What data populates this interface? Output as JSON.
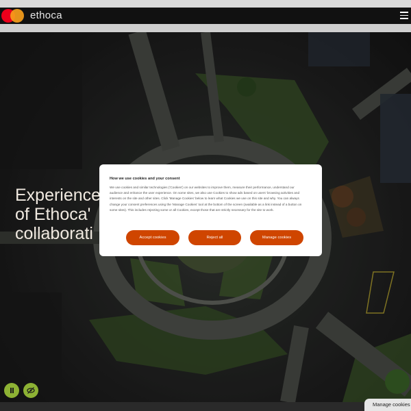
{
  "header": {
    "brand": "ethoca"
  },
  "hero": {
    "headline_lines": [
      "Experience",
      "of Ethoca'",
      "collaborati"
    ]
  },
  "controls": {
    "pause": "pause-control",
    "hide": "eye-off-control"
  },
  "cookie_modal": {
    "title": "How we use cookies and your consent",
    "body": "We use cookies and similar technologies ('Cookies') on our websites to improve them, measure their performance, understand our audience and enhance the user experience. On some sites, we also use Cookies to show ads based on users' browsing activities and interests on the site and other sites. Click 'Manage Cookies' below to learn what Cookies we use on this site and why. You can always change your consent preferences using the 'Manage Cookies' tool at the bottom of the screen (available as a link instead of a button on some sites). This includes rejecting some or all Cookies, except those that are strictly necessary for the site to work.",
    "accept_label": "Accept cookies",
    "reject_label": "Reject all",
    "manage_label": "Manage cookies"
  },
  "manage_tab_label": "Manage cookies",
  "colors": {
    "accent": "#cf4500",
    "control_green": "#8db234",
    "header_bg": "#111111"
  }
}
